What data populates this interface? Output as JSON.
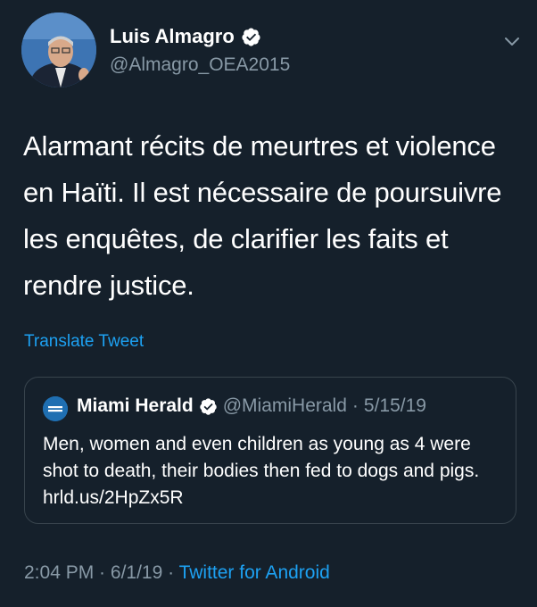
{
  "author": {
    "name": "Luis Almagro",
    "handle": "@Almagro_OEA2015"
  },
  "tweet": {
    "text": "Alarmant récits de meurtres et violence en Haïti. Il est nécessaire de poursuivre les enquêtes, de clarifier les faits et rendre justice.",
    "translate_label": "Translate Tweet"
  },
  "quoted": {
    "name": "Miami Herald",
    "handle": "@MiamiHerald",
    "separator": "·",
    "date": "5/15/19",
    "text": "Men, women and even children as young as 4 were shot to death, their bodies then fed to dogs and pigs. hrld.us/2HpZx5R"
  },
  "meta": {
    "time": "2:04 PM",
    "separator": " · ",
    "date": "6/1/19",
    "via": "Twitter for Android"
  },
  "colors": {
    "background": "#15202b",
    "accent": "#1da1f2",
    "muted": "#8899a6",
    "border": "#38444d"
  },
  "icons": {
    "verified": "verified-badge-icon",
    "more": "chevron-down-icon"
  }
}
